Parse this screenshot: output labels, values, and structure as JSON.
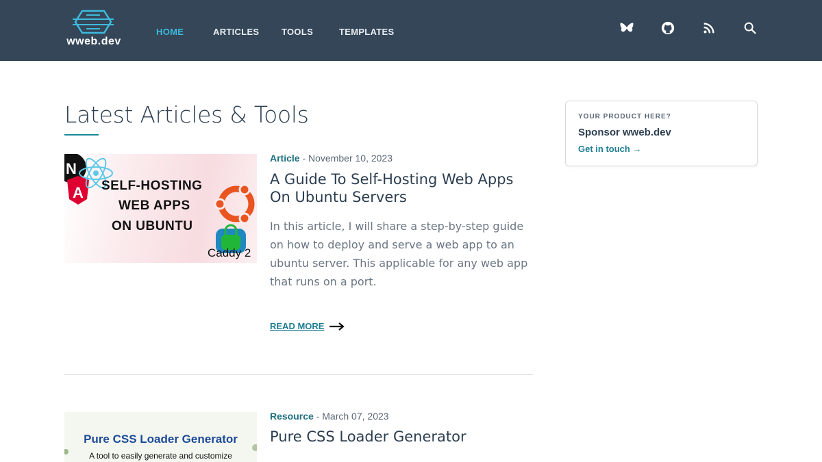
{
  "header": {
    "logo_text": "wweb.dev",
    "nav": [
      {
        "label": "HOME",
        "active": true
      },
      {
        "label": "ARTICLES",
        "active": false
      },
      {
        "label": "TOOLS",
        "active": false
      },
      {
        "label": "TEMPLATES",
        "active": false
      }
    ],
    "icons": [
      "butterfly-icon",
      "github-icon",
      "rss-icon",
      "search-icon"
    ]
  },
  "main": {
    "title": "Latest Articles & Tools",
    "articles": [
      {
        "category": "Article",
        "date": "November 10, 2023",
        "title": "A Guide To Self-Hosting Web Apps On Ubuntu Servers",
        "description": "In this article, I will share a step-by-step guide on how to deploy and serve a web app to an ubuntu server. This applicable for any web app that runs on a port.",
        "read_more": "READ MORE",
        "image_text": [
          "SELF-HOSTING",
          "WEB APPS",
          "ON UBUNTU",
          "Caddy 2"
        ]
      },
      {
        "category": "Resource",
        "date": "March 07, 2023",
        "title": "Pure CSS Loader Generator",
        "image_text": [
          "Pure CSS Loader Generator",
          "A tool to easily generate and customize"
        ]
      }
    ]
  },
  "sponsor": {
    "label": "YOUR PRODUCT HERE?",
    "title": "Sponsor wweb.dev",
    "link": "Get in touch →"
  },
  "colors": {
    "header_bg": "#344658",
    "accent": "#3dbbdd",
    "link": "#1d7d92"
  }
}
